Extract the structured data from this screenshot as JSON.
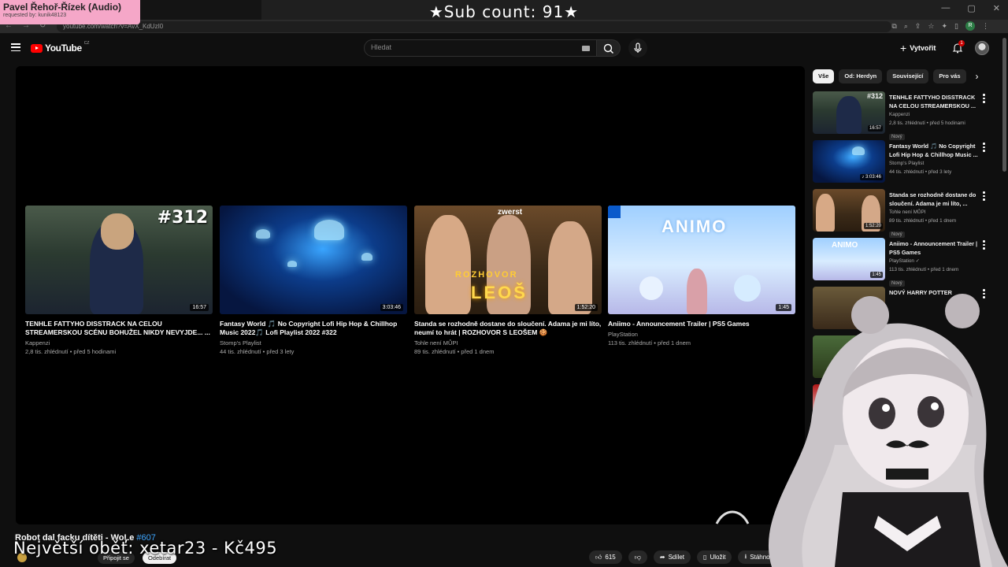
{
  "stream_overlay": {
    "now_playing_title": "Pavel Řehoř-Řízek (Audio)",
    "requested_by": "requested by: kunik48123",
    "sub_count": "★Sub count: 91★",
    "donation_banner": "Největší oběť: xetar23 - Kč495"
  },
  "browser": {
    "url": "youtube.com/watch?v=AvX_KdUzI0"
  },
  "header": {
    "logo_text": "YouTube",
    "logo_country": "CZ",
    "search_placeholder": "Hledat",
    "create_label": "Vytvořit",
    "notification_count": "1"
  },
  "endscreen": {
    "cards": [
      {
        "title": "TENHLE FATTYHO DISSTRACK NA CELOU STREAMERSKOU SCÉNU BOHUŽEL NIKDY NEVYJDE... ...",
        "channel": "Kappenzi",
        "meta": "2,8 tis. zhlédnutí • před 5 hodinami",
        "duration": "16:57",
        "badge": "#312"
      },
      {
        "title": "Fantasy World 🎵 No Copyright Lofi Hip Hop & Chillhop Music 2022🎵 Lofi Playlist 2022 #322",
        "channel": "Stomp's Playlist",
        "meta": "44 tis. zhlédnutí • před 3 lety",
        "duration": "3:03:46"
      },
      {
        "title": "Standa se rozhodně dostane do sloučení. Adama je mi líto, neumí to hrát | ROZHOVOR S LEOŠEM 🍪",
        "channel": "Tohle není MŮPI",
        "meta": "89 tis. zhlédnutí • před 1 dnem",
        "duration": "1:52:20",
        "overlay_top": "ROZHOVOR",
        "overlay_big": "LEOŠ",
        "brand": "zwerst"
      },
      {
        "title": "Aniimo - Announcement Trailer | PS5 Games",
        "channel": "PlayStation",
        "meta": "113 tis. zhlédnutí • před 1 dnem",
        "duration": "1:45",
        "logo": "ANIMO"
      }
    ]
  },
  "video": {
    "title": "Robot dal facku dítěti - WoLe",
    "tag": "#607",
    "join_label": "Připojit se",
    "subscribe_label": "Odebírat",
    "like_count": "615",
    "share_label": "Sdílet",
    "save_label": "Uložit",
    "download_label": "Stáhnout"
  },
  "sidebar": {
    "chips": [
      "Vše",
      "Od: Herdyn",
      "Související",
      "Pro vás"
    ],
    "items": [
      {
        "title": "TENHLE FATTYHO DISSTRACK NA CELOU STREAMERSKOU ...",
        "channel": "Kappenzi",
        "meta": "2,8 tis. zhlédnutí • před 5 hodinami",
        "duration": "16:57",
        "badge": "Nový",
        "thumb_badge": "#312"
      },
      {
        "title": "Fantasy World 🎵 No Copyright Lofi Hip Hop & Chillhop Music ...",
        "channel": "Stomp's Playlist",
        "meta": "44 tis. zhlédnutí • před 3 lety",
        "duration": "♪ 3:03:46",
        "badge": ""
      },
      {
        "title": "Standa se rozhodně dostane do sloučení. Adama je mi líto, ...",
        "channel": "Tohle není MŮPI",
        "meta": "89 tis. zhlédnutí • před 1 dnem",
        "duration": "1:52:20",
        "badge": "Nový"
      },
      {
        "title": "Aniimo - Announcement Trailer | PS5 Games",
        "channel": "PlayStation ✓",
        "meta": "113 tis. zhlédnutí • před 1 dnem",
        "duration": "1:45",
        "badge": "Nový"
      },
      {
        "title": "NOVÝ HARRY POTTER",
        "channel": "",
        "meta": "",
        "duration": "",
        "badge": ""
      }
    ]
  },
  "colors": {
    "accent_red": "#ff0000",
    "background": "#0f0f0f",
    "link_blue": "#3ea6ff",
    "overlay_pink": "#f5a7c8"
  }
}
